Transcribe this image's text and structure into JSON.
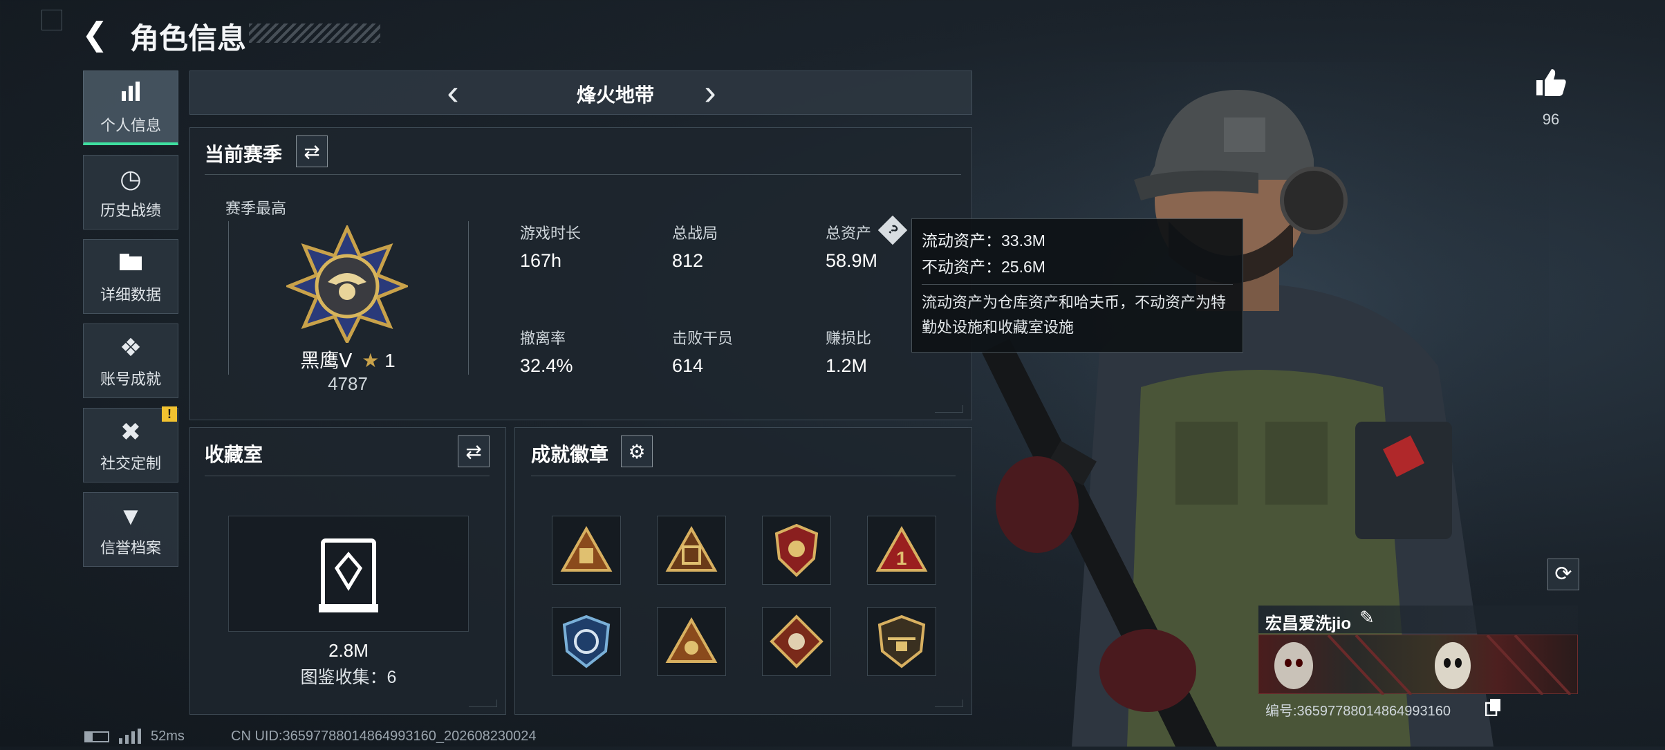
{
  "header": {
    "title": "角色信息",
    "mode_title": "烽火地带"
  },
  "sidebar": {
    "items": [
      {
        "label": "个人信息",
        "icon": "bar-chart-icon",
        "active": true
      },
      {
        "label": "历史战绩",
        "icon": "clock-history-icon"
      },
      {
        "label": "详细数据",
        "icon": "folder-icon"
      },
      {
        "label": "账号成就",
        "icon": "achievement-icon"
      },
      {
        "label": "社交定制",
        "icon": "tools-icon",
        "alert": "!"
      },
      {
        "label": "信誉档案",
        "icon": "shield-wing-icon"
      }
    ]
  },
  "season": {
    "section_title": "当前赛季",
    "best_label": "赛季最高",
    "rank_name": "黑鹰Ⅴ",
    "rank_stars": "1",
    "rank_score": "4787",
    "stats": [
      {
        "label": "游戏时长",
        "value": "167h"
      },
      {
        "label": "总战局",
        "value": "812"
      },
      {
        "label": "总资产",
        "value": "58.9M"
      },
      {
        "label": "撤离率",
        "value": "32.4%"
      },
      {
        "label": "击败干员",
        "value": "614"
      },
      {
        "label": "赚损比",
        "value": "1.2M"
      }
    ],
    "help_icon": "?"
  },
  "tooltip": {
    "line1": "流动资产：33.3M",
    "line2": "不动资产：25.6M",
    "desc": "流动资产为仓库资产和哈夫币，不动资产为特勤处设施和收藏室设施"
  },
  "collection": {
    "section_title": "收藏室",
    "value": "2.8M",
    "count_text": "图鉴收集：6"
  },
  "achievements": {
    "section_title": "成就徽章",
    "badge_count": 8
  },
  "profile": {
    "likes": "96",
    "player_name": "宏昌爱洗jio",
    "id_text": "编号:3659778801486499316​0"
  },
  "status_bar": {
    "ping": "52ms",
    "uid": "CN UID:3659778801486499316​0_202608230024"
  },
  "colors": {
    "accent": "#3ee0a0",
    "alert": "#f2c230",
    "gold": "#c9a24a"
  }
}
